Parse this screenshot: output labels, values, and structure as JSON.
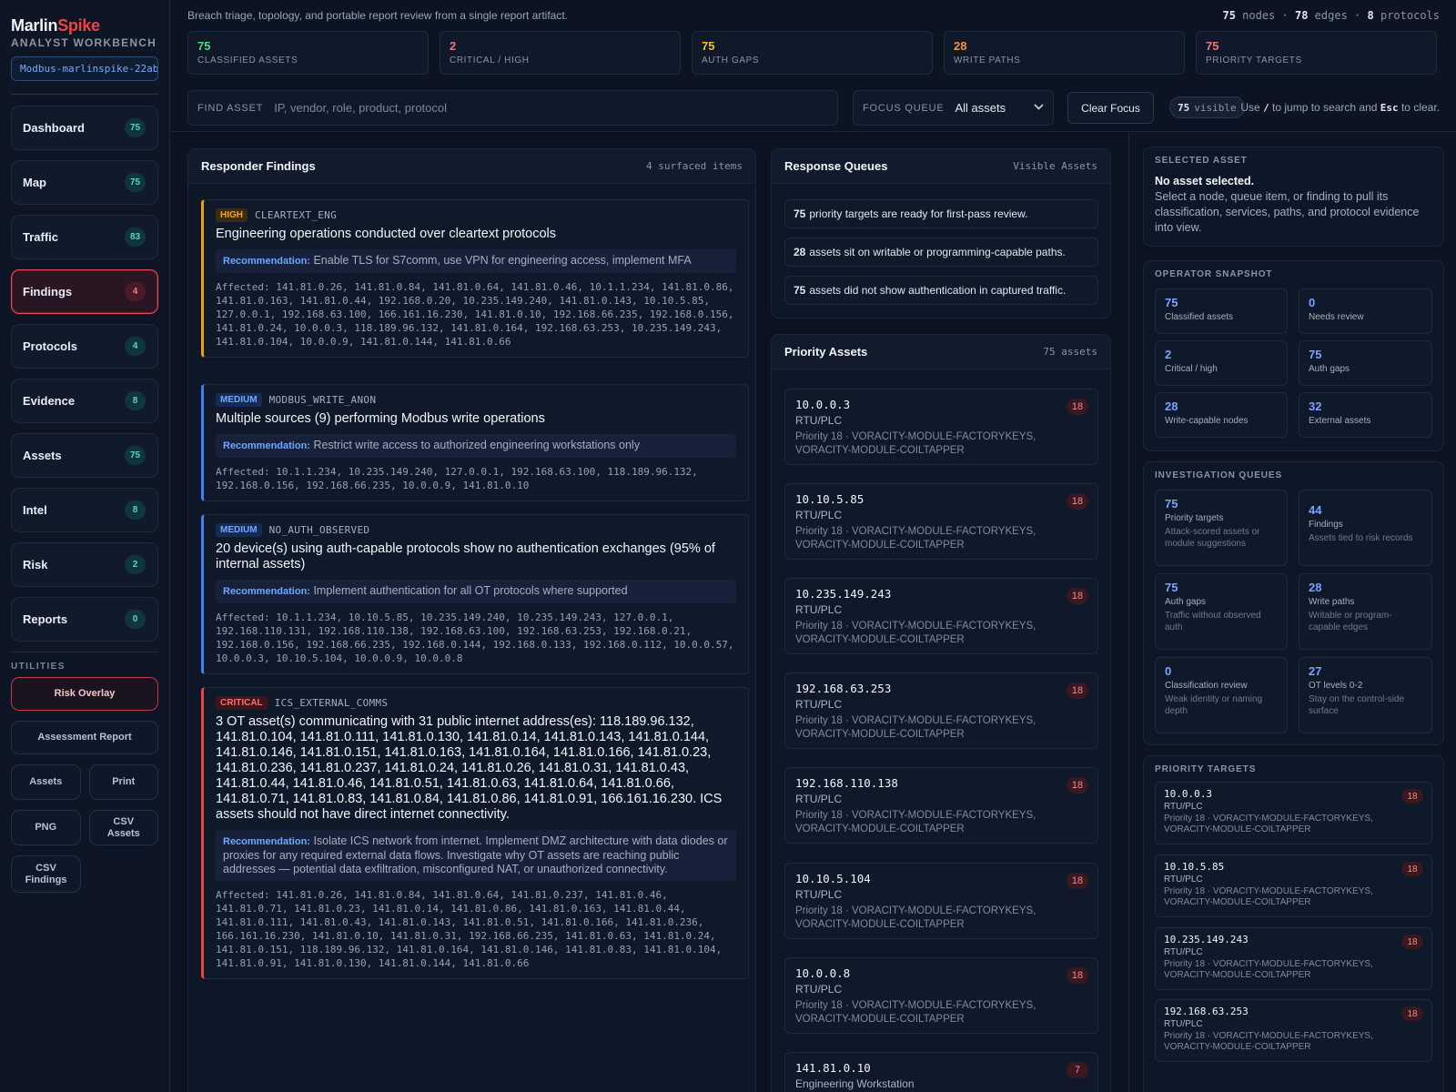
{
  "brand": {
    "name_a": "Marlin",
    "name_b": "Spike",
    "subtitle": "ANALYST WORKBENCH",
    "session": "Modbus-marlinspike-22ab"
  },
  "nav": [
    {
      "label": "Dashboard",
      "badge": "75"
    },
    {
      "label": "Map",
      "badge": "75"
    },
    {
      "label": "Traffic",
      "badge": "83"
    },
    {
      "label": "Findings",
      "badge": "4"
    },
    {
      "label": "Protocols",
      "badge": "4"
    },
    {
      "label": "Evidence",
      "badge": "8"
    },
    {
      "label": "Assets",
      "badge": "75"
    },
    {
      "label": "Intel",
      "badge": "8"
    },
    {
      "label": "Risk",
      "badge": "2"
    },
    {
      "label": "Reports",
      "badge": "0"
    }
  ],
  "utilities": {
    "label": "UTILITIES",
    "risk_overlay": "Risk Overlay",
    "assessment_report": "Assessment Report",
    "assets": "Assets",
    "print": "Print",
    "png": "PNG",
    "csv_assets": "CSV\nAssets",
    "csv_findings": "CSV\nFindings"
  },
  "header": {
    "tagline": "Breach triage, topology, and portable report review from a single report artifact.",
    "nodes": "75",
    "nodes_lbl": "nodes",
    "edges": "78",
    "edges_lbl": "edges",
    "protocols": "8",
    "protocols_lbl": "protocols",
    "sep": "·"
  },
  "stats": [
    {
      "value": "75",
      "label": "CLASSIFIED ASSETS",
      "color": "#4ade80"
    },
    {
      "value": "2",
      "label": "CRITICAL / HIGH",
      "color": "#f87171"
    },
    {
      "value": "75",
      "label": "AUTH GAPS",
      "color": "#fbbf24"
    },
    {
      "value": "28",
      "label": "WRITE PATHS",
      "color": "#fb923c"
    },
    {
      "value": "75",
      "label": "PRIORITY TARGETS",
      "color": "#f87171"
    }
  ],
  "search": {
    "label": "FIND ASSET",
    "placeholder": "IP, vendor, role, product, protocol"
  },
  "focus": {
    "label": "FOCUS QUEUE",
    "value": "All assets"
  },
  "clear_focus": "Clear Focus",
  "visible": {
    "count": "75",
    "label": "visible"
  },
  "hint": {
    "a": "Use ",
    "k1": "/",
    "b": " to jump to search and ",
    "k2": "Esc",
    "c": " to clear."
  },
  "findings_panel": {
    "title": "Responder Findings",
    "meta": "4 surfaced items"
  },
  "findings": [
    {
      "severity": "HIGH",
      "code": "CLEARTEXT_ENG",
      "title": "Engineering operations conducted over cleartext protocols",
      "rec_label": "Recommendation:",
      "recommendation": "Enable TLS for S7comm, use VPN for engineering access, implement MFA",
      "affected": "Affected: 141.81.0.26, 141.81.0.84, 141.81.0.64, 141.81.0.46, 10.1.1.234, 141.81.0.86, 141.81.0.163, 141.81.0.44, 192.168.0.20, 10.235.149.240, 141.81.0.143, 10.10.5.85, 127.0.0.1, 192.168.63.100, 166.161.16.230, 141.81.0.10, 192.168.66.235, 192.168.0.156, 141.81.0.24, 10.0.0.3, 118.189.96.132, 141.81.0.164, 192.168.63.253, 10.235.149.243, 141.81.0.104, 10.0.0.9, 141.81.0.144, 141.81.0.66"
    },
    {
      "severity": "MEDIUM",
      "code": "MODBUS_WRITE_ANON",
      "title": "Multiple sources (9) performing Modbus write operations",
      "rec_label": "Recommendation:",
      "recommendation": "Restrict write access to authorized engineering workstations only",
      "affected": "Affected: 10.1.1.234, 10.235.149.240, 127.0.0.1, 192.168.63.100, 118.189.96.132, 192.168.0.156, 192.168.66.235, 10.0.0.9, 141.81.0.10"
    },
    {
      "severity": "MEDIUM",
      "code": "NO_AUTH_OBSERVED",
      "title": "20 device(s) using auth-capable protocols show no authentication exchanges (95% of internal assets)",
      "rec_label": "Recommendation:",
      "recommendation": "Implement authentication for all OT protocols where supported",
      "affected": "Affected: 10.1.1.234, 10.10.5.85, 10.235.149.240, 10.235.149.243, 127.0.0.1, 192.168.110.131, 192.168.110.138, 192.168.63.100, 192.168.63.253, 192.168.0.21, 192.168.0.156, 192.168.66.235, 192.168.0.144, 192.168.0.133, 192.168.0.112, 10.0.0.57, 10.0.0.3, 10.10.5.104, 10.0.0.9, 10.0.0.8"
    },
    {
      "severity": "CRITICAL",
      "code": "ICS_EXTERNAL_COMMS",
      "title": "3 OT asset(s) communicating with 31 public internet address(es): 118.189.96.132, 141.81.0.104, 141.81.0.111, 141.81.0.130, 141.81.0.14, 141.81.0.143, 141.81.0.144, 141.81.0.146, 141.81.0.151, 141.81.0.163, 141.81.0.164, 141.81.0.166, 141.81.0.23, 141.81.0.236, 141.81.0.237, 141.81.0.24, 141.81.0.26, 141.81.0.31, 141.81.0.43, 141.81.0.44, 141.81.0.46, 141.81.0.51, 141.81.0.63, 141.81.0.64, 141.81.0.66, 141.81.0.71, 141.81.0.83, 141.81.0.84, 141.81.0.86, 141.81.0.91, 166.161.16.230. ICS assets should not have direct internet connectivity.",
      "rec_label": "Recommendation:",
      "recommendation": "Isolate ICS network from internet. Implement DMZ architecture with data diodes or proxies for any required external data flows. Investigate why OT assets are reaching public addresses — potential data exfiltration, misconfigured NAT, or unauthorized connectivity.",
      "affected": "Affected: 141.81.0.26, 141.81.0.84, 141.81.0.64, 141.81.0.237, 141.81.0.46, 141.81.0.71, 141.81.0.23, 141.81.0.14, 141.81.0.86, 141.81.0.163, 141.81.0.44, 141.81.0.111, 141.81.0.43, 141.81.0.143, 141.81.0.51, 141.81.0.166, 141.81.0.236, 166.161.16.230, 141.81.0.10, 141.81.0.31, 192.168.66.235, 141.81.0.63, 141.81.0.24, 141.81.0.151, 118.189.96.132, 141.81.0.164, 141.81.0.146, 141.81.0.83, 141.81.0.104, 141.81.0.91, 141.81.0.130, 141.81.0.144, 141.81.0.66"
    }
  ],
  "queues_panel": {
    "title": "Response Queues",
    "meta": "Visible Assets"
  },
  "queues": [
    {
      "count": "75",
      "text": "priority targets are ready for first-pass review."
    },
    {
      "count": "28",
      "text": "assets sit on writable or programming-capable paths."
    },
    {
      "count": "75",
      "text": "assets did not show authentication in captured traffic."
    }
  ],
  "priority_panel": {
    "title": "Priority Assets",
    "meta": "75 assets"
  },
  "priority_assets": [
    {
      "ip": "10.0.0.3",
      "role": "RTU/PLC",
      "priority": "Priority 18 · VORACITY-MODULE-FACTORYKEYS, VORACITY-MODULE-COILTAPPER",
      "score": "18"
    },
    {
      "ip": "10.10.5.85",
      "role": "RTU/PLC",
      "priority": "Priority 18 · VORACITY-MODULE-FACTORYKEYS, VORACITY-MODULE-COILTAPPER",
      "score": "18"
    },
    {
      "ip": "10.235.149.243",
      "role": "RTU/PLC",
      "priority": "Priority 18 · VORACITY-MODULE-FACTORYKEYS, VORACITY-MODULE-COILTAPPER",
      "score": "18"
    },
    {
      "ip": "192.168.63.253",
      "role": "RTU/PLC",
      "priority": "Priority 18 · VORACITY-MODULE-FACTORYKEYS, VORACITY-MODULE-COILTAPPER",
      "score": "18"
    },
    {
      "ip": "192.168.110.138",
      "role": "RTU/PLC",
      "priority": "Priority 18 · VORACITY-MODULE-FACTORYKEYS, VORACITY-MODULE-COILTAPPER",
      "score": "18"
    },
    {
      "ip": "10.10.5.104",
      "role": "RTU/PLC",
      "priority": "Priority 18 · VORACITY-MODULE-FACTORYKEYS, VORACITY-MODULE-COILTAPPER",
      "score": "18"
    },
    {
      "ip": "10.0.0.8",
      "role": "RTU/PLC",
      "priority": "Priority 18 · VORACITY-MODULE-FACTORYKEYS, VORACITY-MODULE-COILTAPPER",
      "score": "18"
    },
    {
      "ip": "141.81.0.10",
      "role": "Engineering Workstation",
      "priority": "",
      "score": "7"
    }
  ],
  "selected": {
    "title": "SELECTED ASSET",
    "headline": "No asset selected.",
    "body": "Select a node, queue item, or finding to pull its classification, services, paths, and protocol evidence into view."
  },
  "snapshot": {
    "title": "OPERATOR SNAPSHOT",
    "items": [
      {
        "value": "75",
        "label": "Classified assets"
      },
      {
        "value": "0",
        "label": "Needs review"
      },
      {
        "value": "2",
        "label": "Critical / high"
      },
      {
        "value": "75",
        "label": "Auth gaps"
      },
      {
        "value": "28",
        "label": "Write-capable nodes"
      },
      {
        "value": "32",
        "label": "External assets"
      }
    ]
  },
  "investigation": {
    "title": "INVESTIGATION QUEUES",
    "items": [
      {
        "value": "75",
        "label": "Priority targets",
        "sub": "Attack-scored assets or module suggestions"
      },
      {
        "value": "44",
        "label": "Findings",
        "sub": "Assets tied to risk records"
      },
      {
        "value": "75",
        "label": "Auth gaps",
        "sub": "Traffic without observed auth"
      },
      {
        "value": "28",
        "label": "Write paths",
        "sub": "Writable or program-capable edges"
      },
      {
        "value": "0",
        "label": "Classification review",
        "sub": "Weak identity or naming depth"
      },
      {
        "value": "27",
        "label": "OT levels 0-2",
        "sub": "Stay on the control-side surface"
      }
    ]
  },
  "priority_targets": {
    "title": "PRIORITY TARGETS",
    "items": [
      {
        "ip": "10.0.0.3",
        "role": "RTU/PLC",
        "priority": "Priority 18 · VORACITY-MODULE-FACTORYKEYS, VORACITY-MODULE-COILTAPPER",
        "score": "18"
      },
      {
        "ip": "10.10.5.85",
        "role": "RTU/PLC",
        "priority": "Priority 18 · VORACITY-MODULE-FACTORYKEYS, VORACITY-MODULE-COILTAPPER",
        "score": "18"
      },
      {
        "ip": "10.235.149.243",
        "role": "RTU/PLC",
        "priority": "Priority 18 · VORACITY-MODULE-FACTORYKEYS, VORACITY-MODULE-COILTAPPER",
        "score": "18"
      },
      {
        "ip": "192.168.63.253",
        "role": "RTU/PLC",
        "priority": "Priority 18 · VORACITY-MODULE-FACTORYKEYS, VORACITY-MODULE-COILTAPPER",
        "score": "18"
      }
    ]
  },
  "colors": {
    "high": "#f59e0b",
    "medium": "#3b82f6",
    "critical": "#ef4444",
    "accent": "#7aa2ff"
  }
}
